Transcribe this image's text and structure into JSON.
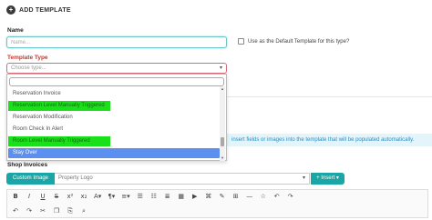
{
  "header": {
    "title": "ADD TEMPLATE",
    "icon": "plus-circle-icon"
  },
  "form": {
    "name_label": "Name",
    "name_placeholder": "Name...",
    "default_checkbox_label": "Use as the Default Template for this type?",
    "type_label": "Template Type",
    "type_placeholder": "Choose type..."
  },
  "dropdown": {
    "options": [
      {
        "label": "Reservation Invoice"
      },
      {
        "label": "Reservation Level Manually Triggered"
      },
      {
        "label": "Reservation Modification"
      },
      {
        "label": "Room Check In Alert"
      },
      {
        "label": "Room Level Manually Triggered"
      },
      {
        "label": "Stay Over"
      }
    ]
  },
  "info_bar": {
    "text": "insert fields or images into the template that will be populated automatically."
  },
  "shop_invoices_label": "Shop Invoices",
  "image_row": {
    "custom_image_label": "Custom Image",
    "selected_image": "Property Logo",
    "insert_label": "+ Insert ▾"
  },
  "colors": {
    "teal": "#1aa6a6",
    "highlight_green": "#19e019",
    "active_blue": "#5b8ff0",
    "error_red": "#c0392b"
  },
  "toolbar": {
    "row1": [
      "B",
      "I",
      "U",
      "S",
      "x²",
      "x₂",
      "A▾",
      "¶▾",
      "≡▾",
      "☰",
      "☷",
      "≣",
      "▦",
      "▶",
      "⌘",
      "✎",
      "⊞",
      "—",
      "☆",
      "↶",
      "↷"
    ],
    "row2": [
      "↶",
      "↷",
      "✂",
      "❐",
      "⎘",
      "⌕"
    ]
  }
}
